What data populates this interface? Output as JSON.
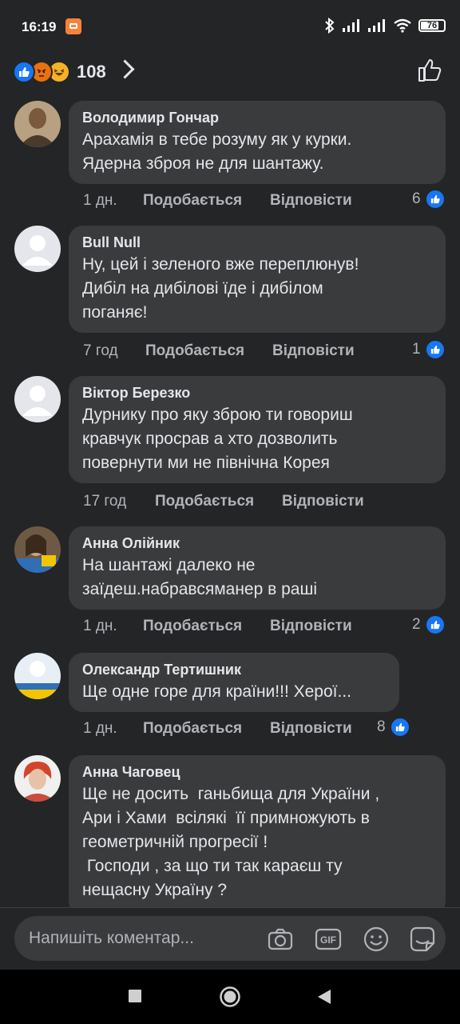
{
  "status": {
    "time": "16:19",
    "battery": "76"
  },
  "header": {
    "reaction_count": "108"
  },
  "comments": [
    {
      "author": "Володимир Гончар",
      "text": "Арахамія в тебе розуму як у курки.\nЯдерна зброя не для шантажу.",
      "time": "1 дн.",
      "like": "Подобається",
      "reply": "Відповісти",
      "likes": "6"
    },
    {
      "author": "Bull Null",
      "text": "Ну, цей і зеленого вже переплюнув!\nДибіл на дибілові їде і дибілом\nпоганяє!",
      "time": "7 год",
      "like": "Подобається",
      "reply": "Відповісти",
      "likes": "1"
    },
    {
      "author": "Віктор Березко",
      "text": "Дурнику про яку зброю ти говориш\nкравчук просрав а хто дозволить\nповернути ми не північна Корея",
      "time": "17 год",
      "like": "Подобається",
      "reply": "Відповісти",
      "likes": ""
    },
    {
      "author": "Анна Олійник",
      "text": "На шантажі далеко не\nзаїдеш.набравсяманер в раші",
      "time": "1 дн.",
      "like": "Подобається",
      "reply": "Відповісти",
      "likes": "2"
    },
    {
      "author": "Олександр Тертишник",
      "text": "Ще одне горе для країни!!! Херої...",
      "time": "1 дн.",
      "like": "Подобається",
      "reply": "Відповісти",
      "likes": "8"
    },
    {
      "author": "Анна Чаговец",
      "text": "Ще не досить  ганьбища для України ,\nАри і Хами  всілякі  її примножують в\nгеометричній прогресії !\n Господи , за що ти так караєш ту\nнещасну Україну ?",
      "time": "",
      "like": "",
      "reply": "",
      "likes": ""
    }
  ],
  "composer": {
    "placeholder": "Напишіть коментар..."
  },
  "colors": {
    "background": "#242526",
    "bubble": "#3a3b3c",
    "accent": "#1877f2",
    "text": "#e4e6eb",
    "muted": "#b0b3b8"
  },
  "icons": [
    "like-reaction-icon",
    "angry-reaction-icon",
    "haha-reaction-icon",
    "chevron-right-icon",
    "thumbs-up-icon",
    "camera-icon",
    "gif-icon",
    "emoji-icon",
    "sticker-icon",
    "home-nav-icon",
    "back-nav-icon",
    "recents-nav-icon"
  ]
}
